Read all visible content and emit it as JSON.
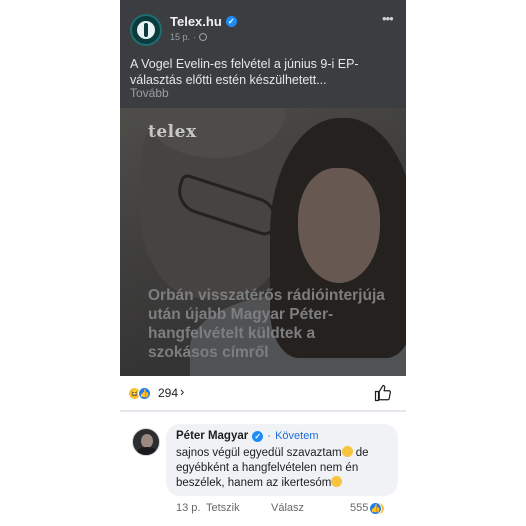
{
  "post": {
    "page_name": "Telex.hu",
    "time": "15 p.",
    "text": "A Vogel Evelin-es felvétel a június 9-i EP-választás előtti estén készülhetett...",
    "see_more": "Tovább"
  },
  "image": {
    "watermark": "telex",
    "headline": "Orbán visszatérős rádióinterjúja után újabb Magyar Péter-hangfelvételt küldtek a szokásos címről"
  },
  "reactions": {
    "count": "294"
  },
  "comment": {
    "author": "Péter Magyar",
    "separator": "·",
    "follow": "Követem",
    "text": "sajnos végül egyedül szavaztam",
    "text2": "de egyébként a hangfelvételen nem én beszélek, hanem az ikertesóm",
    "time": "13 p.",
    "like": "Tetszik",
    "reply": "Válasz",
    "reaction_count": "555"
  },
  "icons": {
    "verified": "verified-badge-icon",
    "more": "more-options-icon",
    "globe": "globe-icon",
    "like": "thumbs-up-icon",
    "chevron": "chevron-right-icon"
  },
  "colors": {
    "header_bg": "#3b3d40",
    "link_blue": "#1d6fdc",
    "bubble_bg": "#f0f2f5",
    "like_blue": "#1d7cf2",
    "haha_yellow": "#f7c43d"
  }
}
